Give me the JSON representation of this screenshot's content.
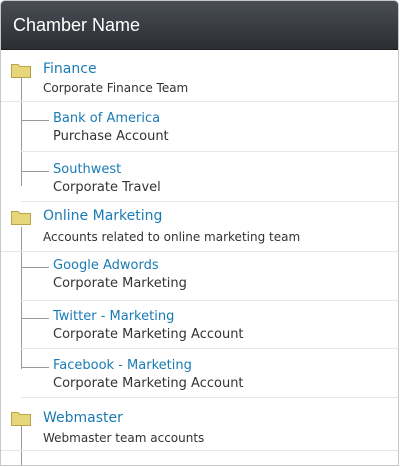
{
  "header": {
    "title": "Chamber Name"
  },
  "groups": [
    {
      "title": "Finance",
      "subtitle": "Corporate Finance Team",
      "children": [
        {
          "title": "Bank of America",
          "subtitle": "Purchase Account"
        },
        {
          "title": "Southwest",
          "subtitle": "Corporate Travel"
        }
      ]
    },
    {
      "title": "Online Marketing",
      "subtitle": "Accounts related to online marketing team",
      "children": [
        {
          "title": "Google Adwords",
          "subtitle": "Corporate Marketing"
        },
        {
          "title": "Twitter - Marketing",
          "subtitle": "Corporate Marketing Account"
        },
        {
          "title": "Facebook - Marketing",
          "subtitle": "Corporate Marketing Account"
        }
      ]
    },
    {
      "title": "Webmaster",
      "subtitle": "Webmaster team accounts",
      "children": []
    }
  ],
  "colors": {
    "link": "#1a7ab5",
    "folder": "#e8d77a",
    "header_bg": "#2f3237"
  }
}
